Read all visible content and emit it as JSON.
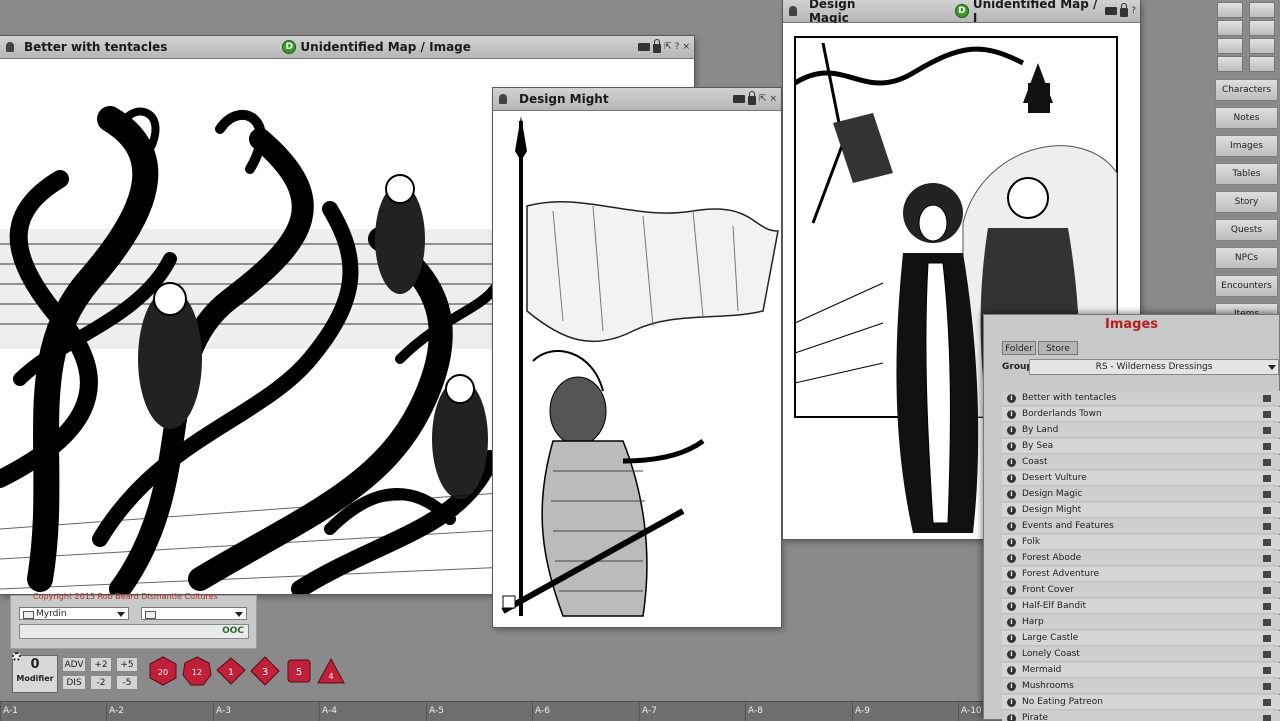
{
  "windows": {
    "tentacles": {
      "title": "Better with tentacles",
      "id_label": "Unidentified Map / Image"
    },
    "might": {
      "title": "Design Might"
    },
    "magic": {
      "title": "Design Magic",
      "id_label": "Unidentified Map / I"
    }
  },
  "toolbar_glyphs": {
    "pin": "⇱",
    "help": "?",
    "close": "×"
  },
  "chat": {
    "copyright": "Copyright 2015 Rob Beard Dismantle Cultures",
    "identity": "Myrdin",
    "language": "",
    "mode": "OOC"
  },
  "dice_bar": {
    "modifier_value": "0",
    "modifier_label": "Modifier",
    "adv": "ADV",
    "dis": "DIS",
    "plus2": "+2",
    "plus5": "+5",
    "minus2": "-2",
    "minus5": "-5",
    "dice": [
      {
        "name": "d20-icon",
        "face": "20"
      },
      {
        "name": "d12-icon",
        "face": "12"
      },
      {
        "name": "d10-icon",
        "face": "1"
      },
      {
        "name": "d8-icon",
        "face": "3"
      },
      {
        "name": "d6-icon",
        "face": "5"
      },
      {
        "name": "d4-icon",
        "face": "4"
      }
    ],
    "die_color": "#c0203a"
  },
  "ruler": [
    "A-1",
    "A-2",
    "A-3",
    "A-4",
    "A-5",
    "A-6",
    "A-7",
    "A-8",
    "A-9",
    "A-10"
  ],
  "sidebar": {
    "buttons": [
      "Characters",
      "Notes",
      "Images",
      "Tables",
      "Story",
      "Quests",
      "NPCs",
      "Encounters",
      "Items"
    ]
  },
  "images_panel": {
    "title": "Images",
    "tabs": [
      "Folder",
      "Store"
    ],
    "group_label": "Group",
    "group_value": "RS - Wilderness Dressings",
    "items": [
      "Better with tentacles",
      "Borderlands Town",
      "By Land",
      "By Sea",
      "Coast",
      "Desert Vulture",
      "Design Magic",
      "Design Might",
      "Events and Features",
      "Folk",
      "Forest Abode",
      "Forest Adventure",
      "Front Cover",
      "Half-Elf Bandit",
      "Harp",
      "Large Castle",
      "Lonely Coast",
      "Mermaid",
      "Mushrooms",
      "No Eating Patreon",
      "Pirate"
    ]
  },
  "colors": {
    "title_red": "#b42020",
    "id_green": "#3a9b2b"
  }
}
